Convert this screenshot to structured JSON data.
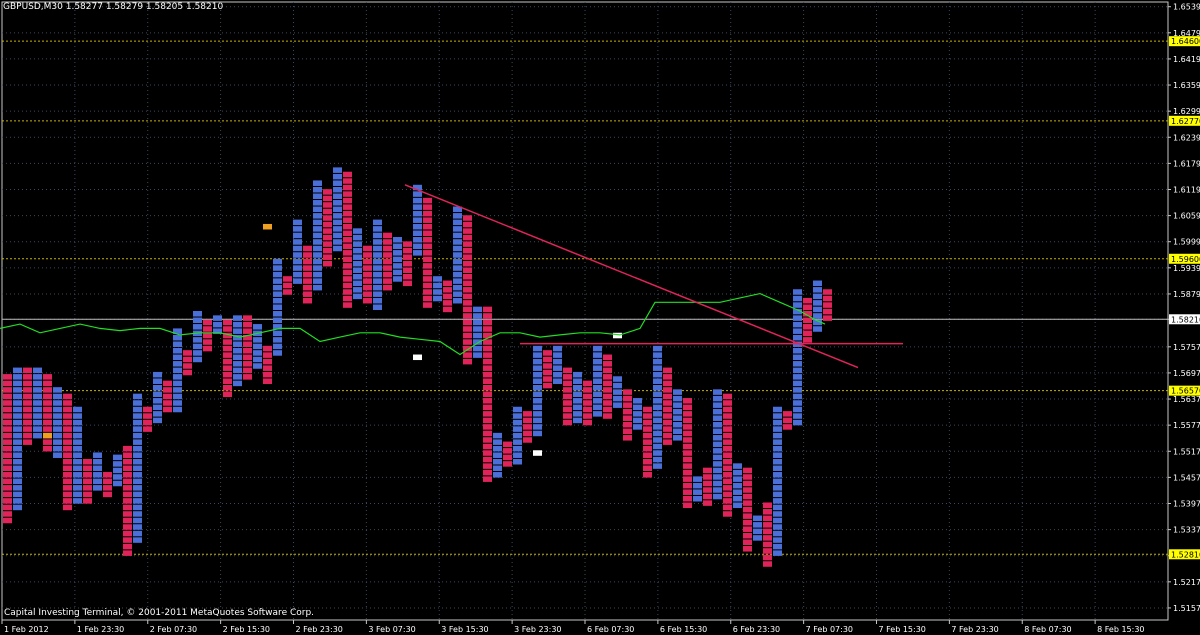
{
  "header": {
    "symbol_info": "GBPUSD,M30  1.58277 1.58279 1.58205 1.58210"
  },
  "footer": {
    "copyright": "Capital Investing Terminal, © 2001-2011 MetaQuotes Software Corp."
  },
  "colors": {
    "background": "#000000",
    "grid": "#3a4a5a",
    "axis": "#c8c8c8",
    "up_box": "#4a6fd8",
    "down_box": "#e0245a",
    "price_line": "#22dd22",
    "trend_line": "#e0245a",
    "level_line": "#c8b400",
    "level_label_bg": "#ffff00",
    "current_price_line": "#c0c0c0"
  },
  "chart_data": {
    "type": "point-and-figure",
    "symbol": "GBPUSD",
    "timeframe": "M30",
    "ylim": [
      1.513,
      1.655
    ],
    "y_ticks": [
      "1.65392",
      "1.64792",
      "1.64192",
      "1.63592",
      "1.62992",
      "1.62392",
      "1.61792",
      "1.61192",
      "1.60592",
      "1.59992",
      "1.59392",
      "1.58792",
      "1.58210",
      "1.57577",
      "1.56977",
      "1.56377",
      "1.55777",
      "1.55177",
      "1.54577",
      "1.53977",
      "1.53377",
      "1.52777",
      "1.52177",
      "1.51577"
    ],
    "x_ticks": [
      "1 Feb 2012",
      "1 Feb 23:30",
      "2 Feb 07:30",
      "2 Feb 15:30",
      "2 Feb 23:30",
      "3 Feb 07:30",
      "3 Feb 15:30",
      "3 Feb 23:30",
      "6 Feb 07:30",
      "6 Feb 15:30",
      "6 Feb 23:30",
      "7 Feb 07:30",
      "7 Feb 15:30",
      "7 Feb 23:30",
      "8 Feb 07:30",
      "8 Feb 15:30"
    ],
    "horizontal_levels": [
      {
        "price": 1.646,
        "label": "1.64600"
      },
      {
        "price": 1.6277,
        "label": "1.62770"
      },
      {
        "price": 1.596,
        "label": "1.59600"
      },
      {
        "price": 1.5657,
        "label": "1.56570"
      },
      {
        "price": 1.5281,
        "label": "1.52810"
      }
    ],
    "current_price": {
      "price": 1.5821,
      "label": "1.58210"
    },
    "box_size": 0.0015,
    "columns": [
      {
        "dir": "down",
        "top": 1.5695,
        "bottom": 1.535
      },
      {
        "dir": "up",
        "top": 1.571,
        "bottom": 1.538
      },
      {
        "dir": "down",
        "top": 1.571,
        "bottom": 1.553
      },
      {
        "dir": "up",
        "top": 1.571,
        "bottom": 1.555
      },
      {
        "dir": "down",
        "top": 1.5695,
        "bottom": 1.551
      },
      {
        "dir": "up",
        "top": 1.5665,
        "bottom": 1.55
      },
      {
        "dir": "down",
        "top": 1.565,
        "bottom": 1.538
      },
      {
        "dir": "up",
        "top": 1.562,
        "bottom": 1.54
      },
      {
        "dir": "down",
        "top": 1.55,
        "bottom": 1.54
      },
      {
        "dir": "up",
        "top": 1.5515,
        "bottom": 1.543
      },
      {
        "dir": "down",
        "top": 1.547,
        "bottom": 1.541
      },
      {
        "dir": "up",
        "top": 1.551,
        "bottom": 1.544
      },
      {
        "dir": "down",
        "top": 1.553,
        "bottom": 1.528
      },
      {
        "dir": "up",
        "top": 1.565,
        "bottom": 1.53
      },
      {
        "dir": "down",
        "top": 1.562,
        "bottom": 1.556
      },
      {
        "dir": "up",
        "top": 1.57,
        "bottom": 1.558
      },
      {
        "dir": "down",
        "top": 1.568,
        "bottom": 1.56
      },
      {
        "dir": "up",
        "top": 1.58,
        "bottom": 1.561
      },
      {
        "dir": "down",
        "top": 1.575,
        "bottom": 1.569
      },
      {
        "dir": "up",
        "top": 1.584,
        "bottom": 1.572
      },
      {
        "dir": "down",
        "top": 1.582,
        "bottom": 1.574
      },
      {
        "dir": "up",
        "top": 1.583,
        "bottom": 1.578
      },
      {
        "dir": "down",
        "top": 1.582,
        "bottom": 1.564
      },
      {
        "dir": "up",
        "top": 1.583,
        "bottom": 1.567
      },
      {
        "dir": "down",
        "top": 1.583,
        "bottom": 1.568
      },
      {
        "dir": "up",
        "top": 1.581,
        "bottom": 1.571
      },
      {
        "dir": "down",
        "top": 1.576,
        "bottom": 1.567
      },
      {
        "dir": "up",
        "top": 1.596,
        "bottom": 1.573
      },
      {
        "dir": "down",
        "top": 1.592,
        "bottom": 1.588
      },
      {
        "dir": "up",
        "top": 1.605,
        "bottom": 1.59
      },
      {
        "dir": "down",
        "top": 1.599,
        "bottom": 1.585
      },
      {
        "dir": "up",
        "top": 1.614,
        "bottom": 1.588
      },
      {
        "dir": "down",
        "top": 1.612,
        "bottom": 1.594
      },
      {
        "dir": "up",
        "top": 1.617,
        "bottom": 1.597
      },
      {
        "dir": "down",
        "top": 1.616,
        "bottom": 1.585
      },
      {
        "dir": "up",
        "top": 1.603,
        "bottom": 1.587
      },
      {
        "dir": "down",
        "top": 1.599,
        "bottom": 1.585
      },
      {
        "dir": "up",
        "top": 1.605,
        "bottom": 1.584
      },
      {
        "dir": "down",
        "top": 1.602,
        "bottom": 1.588
      },
      {
        "dir": "up",
        "top": 1.601,
        "bottom": 1.59
      },
      {
        "dir": "down",
        "top": 1.6,
        "bottom": 1.59
      },
      {
        "dir": "up",
        "top": 1.613,
        "bottom": 1.596
      },
      {
        "dir": "down",
        "top": 1.61,
        "bottom": 1.585
      },
      {
        "dir": "up",
        "top": 1.592,
        "bottom": 1.586
      },
      {
        "dir": "down",
        "top": 1.591,
        "bottom": 1.583
      },
      {
        "dir": "up",
        "top": 1.608,
        "bottom": 1.586
      },
      {
        "dir": "down",
        "top": 1.606,
        "bottom": 1.572
      },
      {
        "dir": "up",
        "top": 1.585,
        "bottom": 1.573
      },
      {
        "dir": "down",
        "top": 1.585,
        "bottom": 1.545
      },
      {
        "dir": "up",
        "top": 1.556,
        "bottom": 1.546
      },
      {
        "dir": "down",
        "top": 1.554,
        "bottom": 1.548
      },
      {
        "dir": "up",
        "top": 1.562,
        "bottom": 1.549
      },
      {
        "dir": "down",
        "top": 1.561,
        "bottom": 1.553
      },
      {
        "dir": "up",
        "top": 1.576,
        "bottom": 1.555
      },
      {
        "dir": "down",
        "top": 1.575,
        "bottom": 1.566
      },
      {
        "dir": "up",
        "top": 1.576,
        "bottom": 1.567
      },
      {
        "dir": "down",
        "top": 1.571,
        "bottom": 1.557
      },
      {
        "dir": "up",
        "top": 1.57,
        "bottom": 1.558
      },
      {
        "dir": "down",
        "top": 1.568,
        "bottom": 1.557
      },
      {
        "dir": "up",
        "top": 1.576,
        "bottom": 1.56
      },
      {
        "dir": "down",
        "top": 1.574,
        "bottom": 1.559
      },
      {
        "dir": "up",
        "top": 1.569,
        "bottom": 1.561
      },
      {
        "dir": "down",
        "top": 1.566,
        "bottom": 1.554
      },
      {
        "dir": "up",
        "top": 1.564,
        "bottom": 1.556
      },
      {
        "dir": "down",
        "top": 1.562,
        "bottom": 1.545
      },
      {
        "dir": "up",
        "top": 1.576,
        "bottom": 1.547
      },
      {
        "dir": "down",
        "top": 1.571,
        "bottom": 1.553
      },
      {
        "dir": "up",
        "top": 1.566,
        "bottom": 1.554
      },
      {
        "dir": "down",
        "top": 1.564,
        "bottom": 1.538
      },
      {
        "dir": "up",
        "top": 1.546,
        "bottom": 1.54
      },
      {
        "dir": "down",
        "top": 1.548,
        "bottom": 1.539
      },
      {
        "dir": "up",
        "top": 1.566,
        "bottom": 1.541
      },
      {
        "dir": "down",
        "top": 1.565,
        "bottom": 1.537
      },
      {
        "dir": "up",
        "top": 1.549,
        "bottom": 1.539
      },
      {
        "dir": "down",
        "top": 1.548,
        "bottom": 1.529
      },
      {
        "dir": "up",
        "top": 1.537,
        "bottom": 1.531
      },
      {
        "dir": "down",
        "top": 1.54,
        "bottom": 1.525
      },
      {
        "dir": "up",
        "top": 1.562,
        "bottom": 1.527
      },
      {
        "dir": "down",
        "top": 1.561,
        "bottom": 1.557
      },
      {
        "dir": "up",
        "top": 1.589,
        "bottom": 1.558
      },
      {
        "dir": "down",
        "top": 1.587,
        "bottom": 1.577
      },
      {
        "dir": "up",
        "top": 1.591,
        "bottom": 1.579
      },
      {
        "dir": "down",
        "top": 1.589,
        "bottom": 1.581
      }
    ],
    "highlight_boxes": [
      {
        "col": 26,
        "price": 1.604,
        "color": "#f0a020"
      },
      {
        "col": 4,
        "price": 1.556,
        "color": "#f0a020"
      },
      {
        "col": 41,
        "price": 1.574,
        "color": "#ffffff"
      },
      {
        "col": 53,
        "price": 1.552,
        "color": "#ffffff"
      },
      {
        "col": 61,
        "price": 1.579,
        "color": "#ffffff"
      }
    ],
    "price_line_points": [
      [
        0,
        1.58
      ],
      [
        20,
        1.581
      ],
      [
        40,
        1.579
      ],
      [
        60,
        1.58
      ],
      [
        80,
        1.581
      ],
      [
        100,
        1.58
      ],
      [
        120,
        1.5795
      ],
      [
        140,
        1.58
      ],
      [
        160,
        1.58
      ],
      [
        180,
        1.5785
      ],
      [
        200,
        1.579
      ],
      [
        220,
        1.579
      ],
      [
        240,
        1.578
      ],
      [
        260,
        1.579
      ],
      [
        280,
        1.58
      ],
      [
        300,
        1.58
      ],
      [
        320,
        1.577
      ],
      [
        340,
        1.578
      ],
      [
        360,
        1.579
      ],
      [
        380,
        1.579
      ],
      [
        400,
        1.578
      ],
      [
        420,
        1.5775
      ],
      [
        440,
        1.577
      ],
      [
        460,
        1.574
      ],
      [
        480,
        1.577
      ],
      [
        500,
        1.579
      ],
      [
        520,
        1.579
      ],
      [
        540,
        1.578
      ],
      [
        560,
        1.5785
      ],
      [
        580,
        1.579
      ],
      [
        600,
        1.579
      ],
      [
        620,
        1.5785
      ],
      [
        640,
        1.58
      ],
      [
        655,
        1.586
      ],
      [
        680,
        1.586
      ],
      [
        700,
        1.586
      ],
      [
        720,
        1.586
      ],
      [
        740,
        1.587
      ],
      [
        760,
        1.588
      ],
      [
        780,
        1.586
      ],
      [
        800,
        1.584
      ],
      [
        815,
        1.582
      ],
      [
        825,
        1.581
      ]
    ],
    "trend_lines": [
      {
        "x1": 405,
        "p1": 1.613,
        "x2": 858,
        "p2": 1.571
      },
      {
        "x1": 520,
        "p1": 1.5765,
        "x2": 903,
        "p2": 1.5765
      }
    ]
  }
}
